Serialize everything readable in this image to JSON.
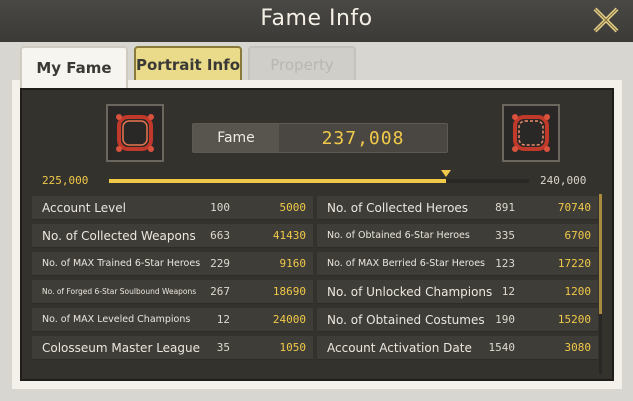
{
  "window": {
    "title": "Fame Info"
  },
  "tabs": [
    {
      "label": "My Fame",
      "selected": true
    },
    {
      "label": "Portrait Info",
      "selected": false
    },
    {
      "label": "Property",
      "selected": false
    }
  ],
  "fame": {
    "label": "Fame",
    "value": "237,008",
    "min": "225,000",
    "max": "240,000",
    "progress_fraction": 0.802
  },
  "stats": {
    "left": [
      {
        "label": "Account Level",
        "count": "100",
        "points": "5000",
        "size": "normal"
      },
      {
        "label": "No. of Collected Weapons",
        "count": "663",
        "points": "41430",
        "size": "normal"
      },
      {
        "label": "No. of MAX Trained 6-Star Heroes",
        "count": "229",
        "points": "9160",
        "size": "small"
      },
      {
        "label": "No. of Forged 6-Star Soulbound Weapons",
        "count": "267",
        "points": "18690",
        "size": "tiny"
      },
      {
        "label": "No. of MAX Leveled Champions",
        "count": "12",
        "points": "24000",
        "size": "small"
      },
      {
        "label": "Colosseum Master League",
        "count": "35",
        "points": "1050",
        "size": "normal"
      }
    ],
    "right": [
      {
        "label": "No. of Collected Heroes",
        "count": "891",
        "points": "70740",
        "size": "normal"
      },
      {
        "label": "No. of Obtained 6-Star Heroes",
        "count": "335",
        "points": "6700",
        "size": "small"
      },
      {
        "label": "No. of MAX Berried 6-Star Heroes",
        "count": "123",
        "points": "17220",
        "size": "small"
      },
      {
        "label": "No. of Unlocked Champions",
        "count": "12",
        "points": "1200",
        "size": "normal"
      },
      {
        "label": "No. of Obtained Costumes",
        "count": "190",
        "points": "15200",
        "size": "normal"
      },
      {
        "label": "Account Activation Date",
        "count": "1540",
        "points": "3080",
        "size": "normal"
      }
    ]
  },
  "colors": {
    "accent": "#f1c94a",
    "panel": "#34322d",
    "frame": "#c0392b"
  },
  "icons": {
    "close": "close-icon",
    "portrait": "portrait-frame-icon"
  }
}
